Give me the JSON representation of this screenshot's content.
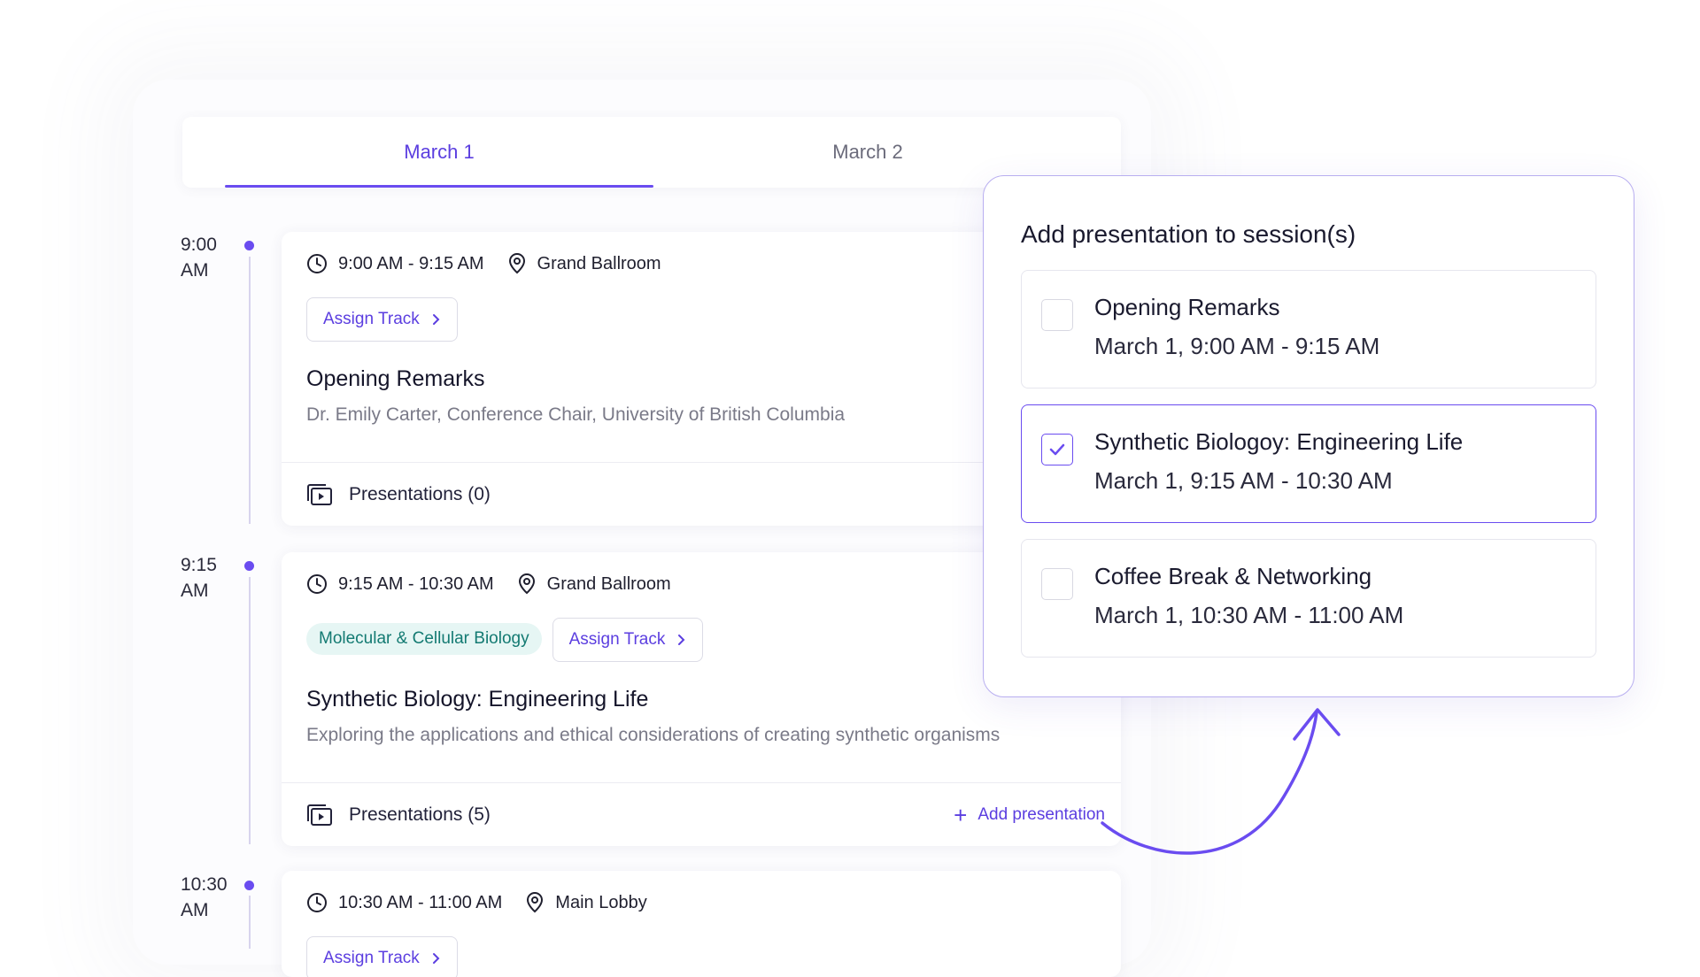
{
  "tabs": [
    {
      "label": "March 1",
      "active": true
    },
    {
      "label": "March 2",
      "active": false
    }
  ],
  "timeline": [
    {
      "hour": "9:00",
      "period": "AM"
    },
    {
      "hour": "9:15",
      "period": "AM"
    },
    {
      "hour": "10:30",
      "period": "AM"
    }
  ],
  "sessions": [
    {
      "time": "9:00 AM - 9:15 AM",
      "location": "Grand Ballroom",
      "assign_track": "Assign Track",
      "title": "Opening Remarks",
      "description": "Dr. Emily Carter, Conference Chair, University of British Columbia",
      "presentations": "Presentations (0)"
    },
    {
      "time": "9:15 AM - 10:30 AM",
      "location": "Grand Ballroom",
      "topic": "Molecular & Cellular Biology",
      "assign_track": "Assign Track",
      "title": "Synthetic Biology: Engineering Life",
      "description": "Exploring the applications and ethical considerations of creating synthetic organisms",
      "presentations": "Presentations (5)",
      "add_presentation": "Add presentation"
    },
    {
      "time": "10:30 AM - 11:00 AM",
      "location": "Main Lobby",
      "assign_track": "Assign Track"
    }
  ],
  "modal": {
    "title": "Add presentation to session(s)",
    "options": [
      {
        "title": "Opening Remarks",
        "time": "March 1, 9:00 AM - 9:15 AM",
        "checked": false
      },
      {
        "title": "Synthetic Biologoy: Engineering Life",
        "time": "March 1, 9:15 AM - 10:30 AM",
        "checked": true
      },
      {
        "title": "Coffee Break & Networking",
        "time": "March 1, 10:30 AM - 11:00 AM",
        "checked": false
      }
    ]
  },
  "colors": {
    "accent": "#6a4cf0",
    "accent_text": "#5b3ee0",
    "topic_bg": "#e6f6f4",
    "topic_text": "#137a72",
    "modal_border": "#b8aef0"
  },
  "icons": [
    "clock-icon",
    "map-pin-icon",
    "chevron-right-icon",
    "presentation-icon",
    "plus-icon",
    "check-icon",
    "curved-arrow-icon"
  ]
}
